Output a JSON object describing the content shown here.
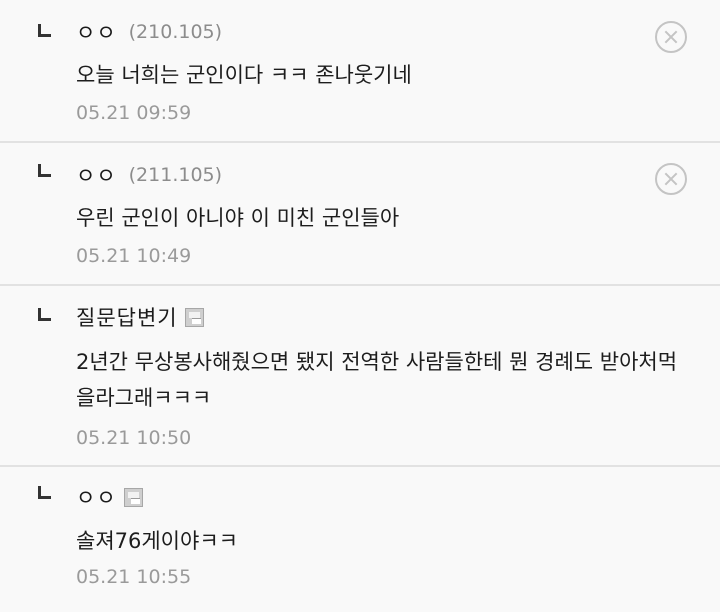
{
  "comments": [
    {
      "nickname": "ㅇㅇ",
      "ip": "(210.105)",
      "text": "오늘 너희는 군인이다 ㅋㅋ 존나웃기네",
      "time": "05.21 09:59"
    },
    {
      "nickname": "ㅇㅇ",
      "ip": "(211.105)",
      "text": "우린 군인이 아니야 이 미친 군인들아",
      "time": "05.21 10:49"
    },
    {
      "nickname": "질문답변기",
      "text": "2년간 무상봉사해줬으면 됐지 전역한 사람들한테 뭔 경례도 받아처먹을라그래ㅋㅋㅋ",
      "time": "05.21 10:50"
    },
    {
      "nickname": "ㅇㅇ",
      "text": "솔져76게이야ㅋㅋ",
      "time": "05.21 10:55"
    }
  ]
}
